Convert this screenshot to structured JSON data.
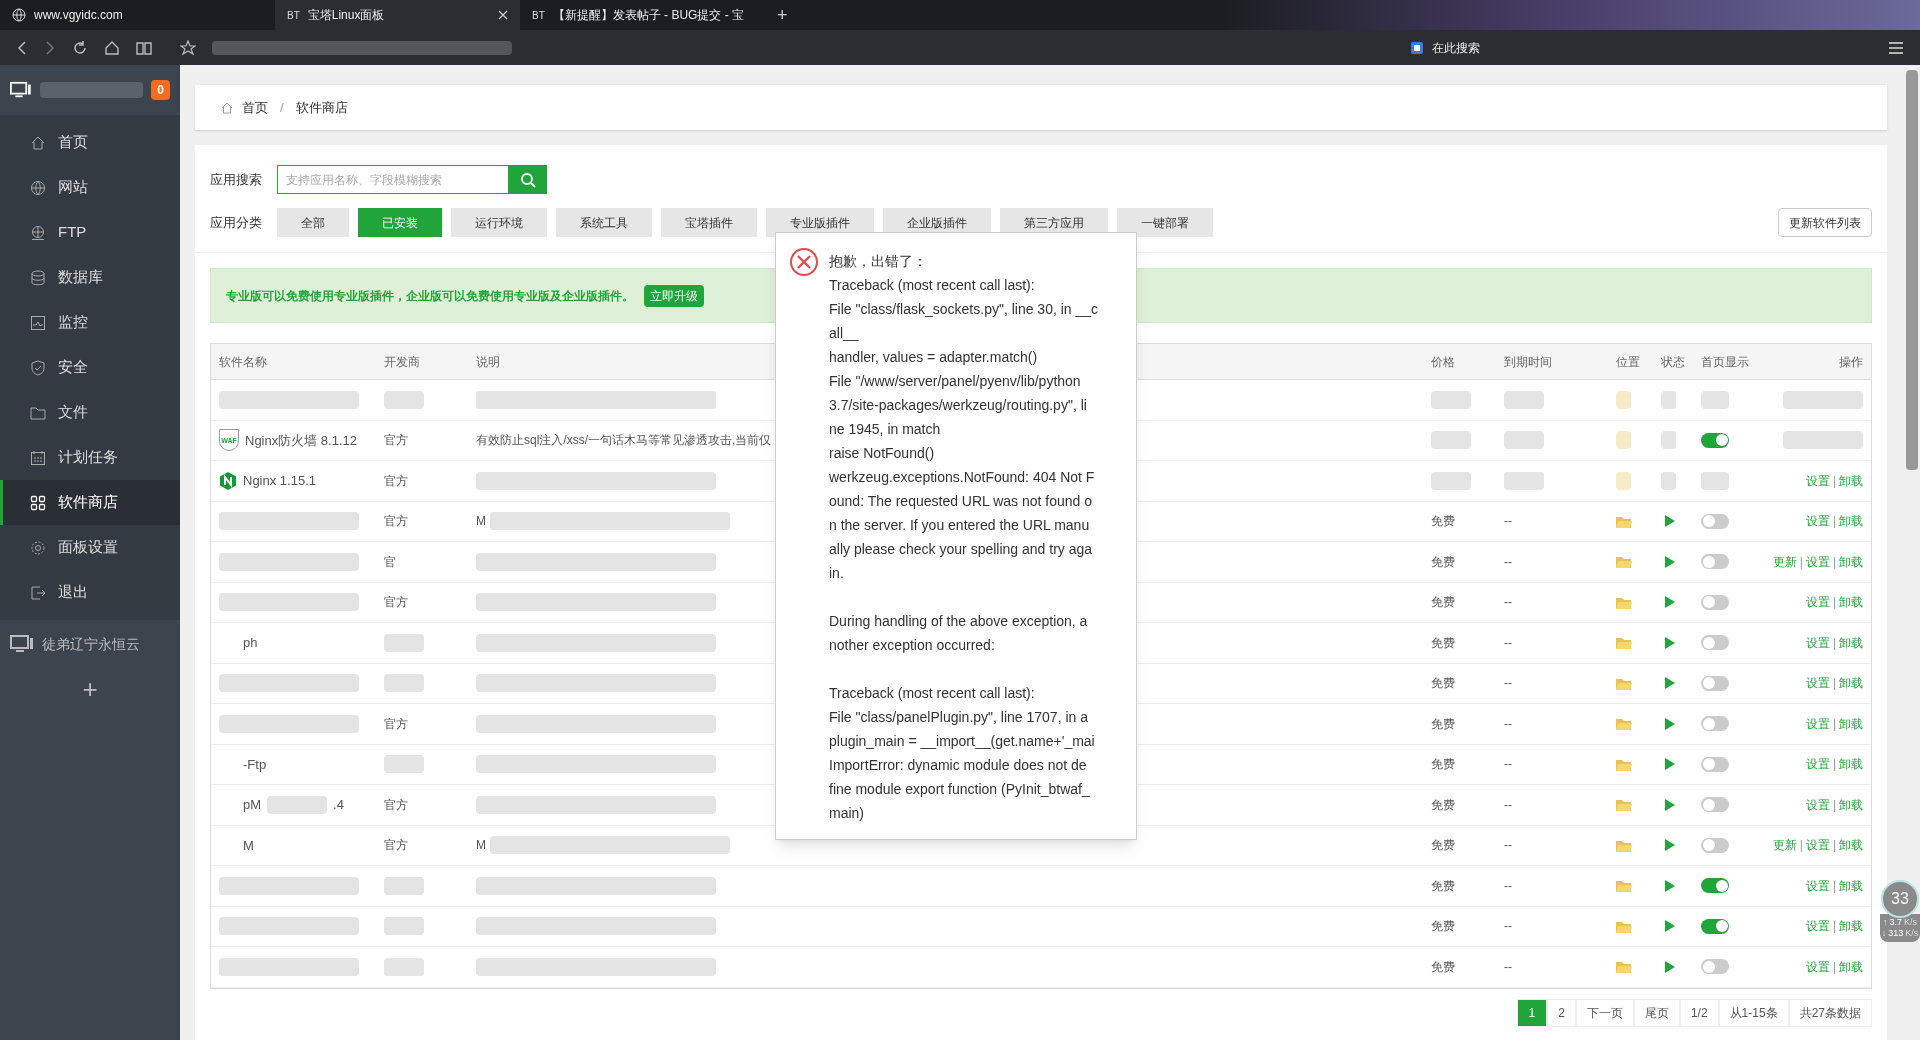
{
  "browser": {
    "tabs": [
      {
        "label": "www.vgyidc.com",
        "kind": "site",
        "selected": false
      },
      {
        "label": "宝塔Linux面板",
        "kind": "bt",
        "favicon_text": "BT",
        "selected": true
      },
      {
        "label": "【新提醒】发表帖子 - BUG提交 - 宝",
        "kind": "bt",
        "favicon_text": "BT",
        "selected": false
      }
    ],
    "new_tab": "+",
    "search_placeholder": "在此搜索"
  },
  "sidebar": {
    "badge": "0",
    "items": [
      {
        "label": "首页",
        "kind": "home",
        "selected": false
      },
      {
        "label": "网站",
        "kind": "globe",
        "selected": false
      },
      {
        "label": "FTP",
        "kind": "ftp",
        "selected": false
      },
      {
        "label": "数据库",
        "kind": "database",
        "selected": false
      },
      {
        "label": "监控",
        "kind": "monitor",
        "selected": false
      },
      {
        "label": "安全",
        "kind": "shield",
        "selected": false
      },
      {
        "label": "文件",
        "kind": "folder",
        "selected": false
      },
      {
        "label": "计划任务",
        "kind": "calendar",
        "selected": false
      },
      {
        "label": "软件商店",
        "kind": "grid",
        "selected": true
      },
      {
        "label": "面板设置",
        "kind": "gear",
        "selected": false
      },
      {
        "label": "退出",
        "kind": "exit",
        "selected": false
      }
    ],
    "server_name": "徒弟辽宁永恒云",
    "add": "+"
  },
  "breadcrumb": [
    {
      "kind": "link",
      "text": "首页"
    },
    {
      "kind": "separator",
      "text": "/"
    },
    {
      "kind": "current",
      "text": "软件商店"
    }
  ],
  "search": {
    "label": "应用搜索",
    "placeholder": "支持应用名称、字段模糊搜索"
  },
  "categories": {
    "label": "应用分类",
    "items": [
      {
        "label": "全部",
        "selected": false
      },
      {
        "label": "已安装",
        "selected": true
      },
      {
        "label": "运行环境",
        "selected": false
      },
      {
        "label": "系统工具",
        "selected": false
      },
      {
        "label": "宝塔插件",
        "selected": false
      },
      {
        "label": "专业版插件",
        "selected": false
      },
      {
        "label": "企业版插件",
        "selected": false
      },
      {
        "label": "第三方应用",
        "selected": false
      },
      {
        "label": "一键部署",
        "selected": false
      }
    ],
    "refresh": "更新软件列表"
  },
  "notice": {
    "text": "专业版可以免费使用专业版插件，企业版可以免费使用专业版及企业版插件。",
    "button": "立即升级"
  },
  "table": {
    "columns": [
      "软件名称",
      "开发商",
      "说明",
      "价格",
      "到期时间",
      "位置",
      "状态",
      "首页显示",
      "操作"
    ],
    "rows": [
      {},
      {
        "kind": "waf",
        "icon_text": "WAF",
        "name": "Nginx防火墙 8.1.12",
        "vendor": "官方",
        "description": "有效防止sql注入/xss/一句话木马等常见渗透攻击,当前仅",
        "home_shown": true
      },
      {
        "kind": "nginx",
        "name": "Nginx 1.15.1",
        "vendor": "官方",
        "actions": [
          "设置",
          "|",
          "卸载"
        ]
      },
      {
        "vendor": "官方",
        "description": "M",
        "price": "免费",
        "expiry": "--",
        "home_shown": false,
        "actions": [
          "设置",
          "|",
          "卸载"
        ]
      },
      {
        "vendor": "官",
        "price": "免费",
        "expiry": "--",
        "home_shown": false,
        "actions": [
          "更新",
          "|",
          "设置",
          "|",
          "卸载"
        ]
      },
      {
        "vendor": "官方",
        "price": "免费",
        "expiry": "--",
        "home_shown": false,
        "actions": [
          "设置",
          "|",
          "卸载"
        ]
      },
      {
        "name": "ph",
        "price": "免费",
        "expiry": "--",
        "home_shown": false,
        "actions": [
          "设置",
          "|",
          "卸载"
        ]
      },
      {
        "price": "免费",
        "expiry": "--",
        "home_shown": false,
        "actions": [
          "设置",
          "|",
          "卸载"
        ]
      },
      {
        "vendor": "官方",
        "price": "免费",
        "expiry": "--",
        "home_shown": false,
        "actions": [
          "设置",
          "|",
          "卸载"
        ]
      },
      {
        "name": "-Ftp",
        "price": "免费",
        "expiry": "--",
        "home_shown": false,
        "actions": [
          "设置",
          "|",
          "卸载"
        ]
      },
      {
        "name": "pM",
        "name_suffix": ".4",
        "vendor": "官方",
        "price": "免费",
        "expiry": "--",
        "home_shown": false,
        "actions": [
          "设置",
          "|",
          "卸载"
        ]
      },
      {
        "name": "M",
        "vendor": "官方",
        "description": "M",
        "price": "免费",
        "expiry": "--",
        "home_shown": false,
        "actions": [
          "更新",
          "|",
          "设置",
          "|",
          "卸载"
        ]
      },
      {
        "price": "免费",
        "expiry": "--",
        "home_shown": true,
        "actions": [
          "设置",
          "|",
          "卸载"
        ]
      },
      {
        "price": "免费",
        "expiry": "--",
        "home_shown": true,
        "actions": [
          "设置",
          "|",
          "卸载"
        ]
      },
      {
        "price": "免费",
        "expiry": "--",
        "home_shown": false,
        "actions": [
          "设置",
          "|",
          "卸载"
        ]
      }
    ]
  },
  "pagination": [
    {
      "label": "1",
      "selected": true
    },
    {
      "label": "2",
      "selected": false
    },
    {
      "label": "下一页",
      "selected": false
    },
    {
      "label": "尾页",
      "selected": false
    },
    {
      "label": "1/2",
      "selected": false
    },
    {
      "label": "从1-15条",
      "selected": false
    },
    {
      "label": "共27条数据",
      "selected": false
    }
  ],
  "error_dialog": {
    "title": "抱歉，出错了：",
    "paragraphs": [
      [
        "Traceback (most recent call last):",
        "File \"class/flask_sockets.py\", line 30, in __c",
        "all__",
        "handler, values = adapter.match()",
        "File \"/www/server/panel/pyenv/lib/python",
        "3.7/site-packages/werkzeug/routing.py\", li",
        "ne 1945, in match",
        "raise NotFound()",
        "werkzeug.exceptions.NotFound: 404 Not F",
        "ound: The requested URL was not found o",
        "n the server. If you entered the URL manu",
        "ally please check your spelling and try aga",
        "in."
      ],
      [
        "During handling of the above exception, a",
        "nother exception occurred:"
      ],
      [
        "Traceback (most recent call last):",
        "File \"class/panelPlugin.py\", line 1707, in a",
        "plugin_main = __import__(get.name+'_mai",
        "ImportError: dynamic module does not de",
        "fine module export function (PyInit_btwaf_",
        "main)"
      ]
    ]
  },
  "speed_widget": {
    "value": "33",
    "up_arrow": "↑",
    "up": "3.7",
    "unit_up": "K/s",
    "down_arrow": "↓",
    "down": "313",
    "unit_down": "K/s"
  }
}
